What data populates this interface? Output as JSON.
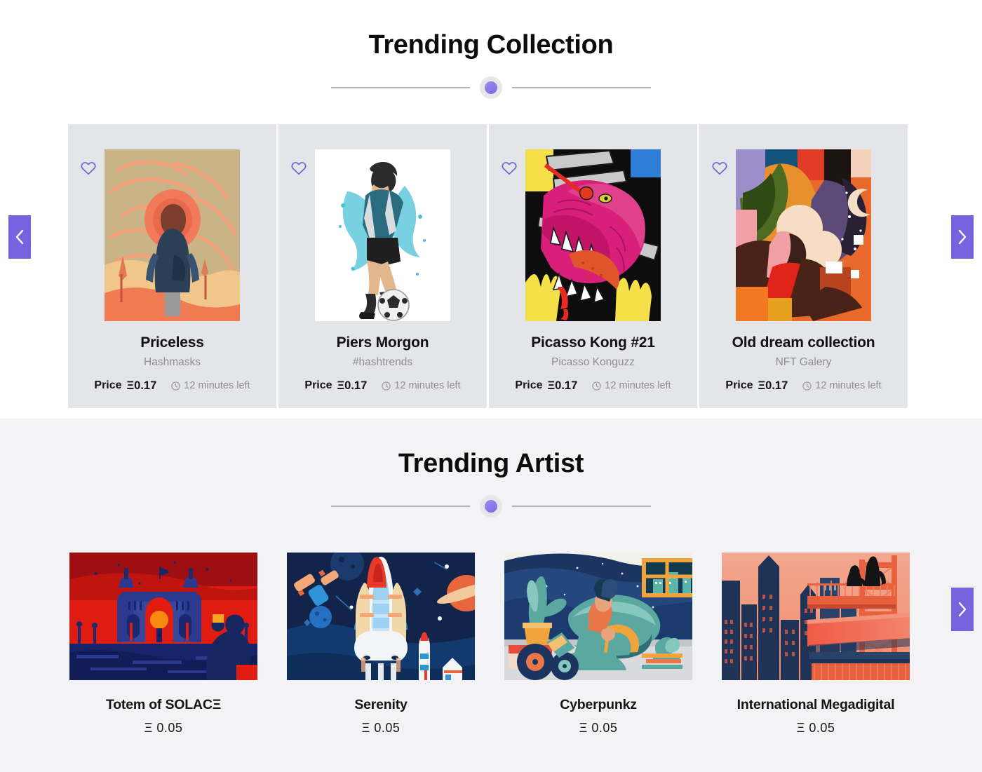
{
  "collection_section": {
    "title": "Trending Collection",
    "prev_arrow_icon": "chevron-left-icon",
    "next_arrow_icon": "chevron-right-icon",
    "accent_color": "#7663dd",
    "card_bg": "#e4e5e8",
    "cards": [
      {
        "title": "Priceless",
        "creator": "Hashmasks",
        "price_label": "Price",
        "price_value": "Ξ0.17",
        "time_left": "12 minutes left",
        "like_icon": "heart-outline-icon",
        "clock_icon": "clock-icon",
        "artwork": "person-watching-sunset-swirl"
      },
      {
        "title": "Piers Morgon",
        "creator": "#hashtrends",
        "price_label": "Price",
        "price_value": "Ξ0.17",
        "time_left": "12 minutes left",
        "like_icon": "heart-outline-icon",
        "clock_icon": "clock-icon",
        "artwork": "soccer-player-splash"
      },
      {
        "title": "Picasso Kong #21",
        "creator": "Picasso Konguzz",
        "price_label": "Price",
        "price_value": "Ξ0.17",
        "time_left": "12 minutes left",
        "like_icon": "heart-outline-icon",
        "clock_icon": "clock-icon",
        "artwork": "pink-dinosaur-comic"
      },
      {
        "title": "Old dream collection",
        "creator": "NFT Galery",
        "price_label": "Price",
        "price_value": "Ξ0.17",
        "time_left": "12 minutes left",
        "like_icon": "heart-outline-icon",
        "clock_icon": "clock-icon",
        "artwork": "abstract-face-moons"
      }
    ]
  },
  "artist_section": {
    "title": "Trending Artist",
    "next_arrow_icon": "chevron-right-icon",
    "background_color": "#f3f3f5",
    "cards": [
      {
        "name": "Totem of SOLACΞ",
        "price": "Ξ 0.05",
        "artwork": "gateway-of-india-red-night"
      },
      {
        "name": "Serenity",
        "price": "Ξ 0.05",
        "artwork": "space-shuttle-launch"
      },
      {
        "name": "Cyberpunkz",
        "price": "Ξ 0.05",
        "artwork": "woman-lounging-night-room"
      },
      {
        "name": "International Megadigital",
        "price": "Ξ 0.05",
        "artwork": "city-skyline-sunset-bridge"
      }
    ]
  }
}
